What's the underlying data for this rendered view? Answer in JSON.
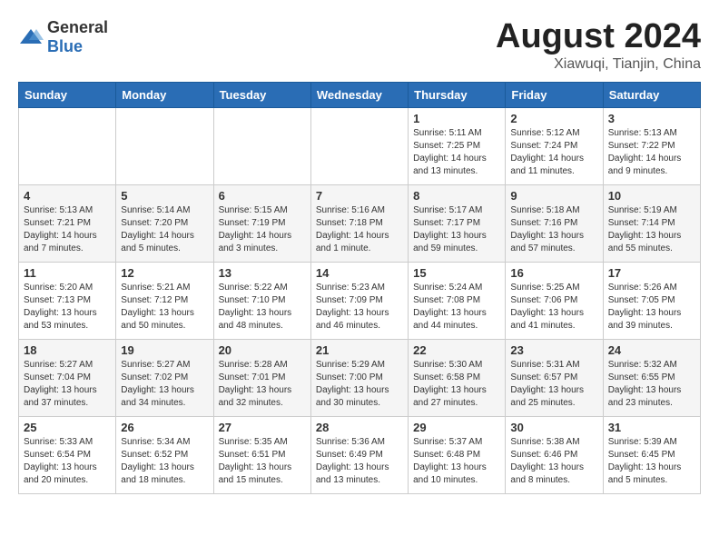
{
  "header": {
    "logo_general": "General",
    "logo_blue": "Blue",
    "title": "August 2024",
    "subtitle": "Xiawuqi, Tianjin, China"
  },
  "weekdays": [
    "Sunday",
    "Monday",
    "Tuesday",
    "Wednesday",
    "Thursday",
    "Friday",
    "Saturday"
  ],
  "weeks": [
    [
      {
        "day": "",
        "info": ""
      },
      {
        "day": "",
        "info": ""
      },
      {
        "day": "",
        "info": ""
      },
      {
        "day": "",
        "info": ""
      },
      {
        "day": "1",
        "info": "Sunrise: 5:11 AM\nSunset: 7:25 PM\nDaylight: 14 hours\nand 13 minutes."
      },
      {
        "day": "2",
        "info": "Sunrise: 5:12 AM\nSunset: 7:24 PM\nDaylight: 14 hours\nand 11 minutes."
      },
      {
        "day": "3",
        "info": "Sunrise: 5:13 AM\nSunset: 7:22 PM\nDaylight: 14 hours\nand 9 minutes."
      }
    ],
    [
      {
        "day": "4",
        "info": "Sunrise: 5:13 AM\nSunset: 7:21 PM\nDaylight: 14 hours\nand 7 minutes."
      },
      {
        "day": "5",
        "info": "Sunrise: 5:14 AM\nSunset: 7:20 PM\nDaylight: 14 hours\nand 5 minutes."
      },
      {
        "day": "6",
        "info": "Sunrise: 5:15 AM\nSunset: 7:19 PM\nDaylight: 14 hours\nand 3 minutes."
      },
      {
        "day": "7",
        "info": "Sunrise: 5:16 AM\nSunset: 7:18 PM\nDaylight: 14 hours\nand 1 minute."
      },
      {
        "day": "8",
        "info": "Sunrise: 5:17 AM\nSunset: 7:17 PM\nDaylight: 13 hours\nand 59 minutes."
      },
      {
        "day": "9",
        "info": "Sunrise: 5:18 AM\nSunset: 7:16 PM\nDaylight: 13 hours\nand 57 minutes."
      },
      {
        "day": "10",
        "info": "Sunrise: 5:19 AM\nSunset: 7:14 PM\nDaylight: 13 hours\nand 55 minutes."
      }
    ],
    [
      {
        "day": "11",
        "info": "Sunrise: 5:20 AM\nSunset: 7:13 PM\nDaylight: 13 hours\nand 53 minutes."
      },
      {
        "day": "12",
        "info": "Sunrise: 5:21 AM\nSunset: 7:12 PM\nDaylight: 13 hours\nand 50 minutes."
      },
      {
        "day": "13",
        "info": "Sunrise: 5:22 AM\nSunset: 7:10 PM\nDaylight: 13 hours\nand 48 minutes."
      },
      {
        "day": "14",
        "info": "Sunrise: 5:23 AM\nSunset: 7:09 PM\nDaylight: 13 hours\nand 46 minutes."
      },
      {
        "day": "15",
        "info": "Sunrise: 5:24 AM\nSunset: 7:08 PM\nDaylight: 13 hours\nand 44 minutes."
      },
      {
        "day": "16",
        "info": "Sunrise: 5:25 AM\nSunset: 7:06 PM\nDaylight: 13 hours\nand 41 minutes."
      },
      {
        "day": "17",
        "info": "Sunrise: 5:26 AM\nSunset: 7:05 PM\nDaylight: 13 hours\nand 39 minutes."
      }
    ],
    [
      {
        "day": "18",
        "info": "Sunrise: 5:27 AM\nSunset: 7:04 PM\nDaylight: 13 hours\nand 37 minutes."
      },
      {
        "day": "19",
        "info": "Sunrise: 5:27 AM\nSunset: 7:02 PM\nDaylight: 13 hours\nand 34 minutes."
      },
      {
        "day": "20",
        "info": "Sunrise: 5:28 AM\nSunset: 7:01 PM\nDaylight: 13 hours\nand 32 minutes."
      },
      {
        "day": "21",
        "info": "Sunrise: 5:29 AM\nSunset: 7:00 PM\nDaylight: 13 hours\nand 30 minutes."
      },
      {
        "day": "22",
        "info": "Sunrise: 5:30 AM\nSunset: 6:58 PM\nDaylight: 13 hours\nand 27 minutes."
      },
      {
        "day": "23",
        "info": "Sunrise: 5:31 AM\nSunset: 6:57 PM\nDaylight: 13 hours\nand 25 minutes."
      },
      {
        "day": "24",
        "info": "Sunrise: 5:32 AM\nSunset: 6:55 PM\nDaylight: 13 hours\nand 23 minutes."
      }
    ],
    [
      {
        "day": "25",
        "info": "Sunrise: 5:33 AM\nSunset: 6:54 PM\nDaylight: 13 hours\nand 20 minutes."
      },
      {
        "day": "26",
        "info": "Sunrise: 5:34 AM\nSunset: 6:52 PM\nDaylight: 13 hours\nand 18 minutes."
      },
      {
        "day": "27",
        "info": "Sunrise: 5:35 AM\nSunset: 6:51 PM\nDaylight: 13 hours\nand 15 minutes."
      },
      {
        "day": "28",
        "info": "Sunrise: 5:36 AM\nSunset: 6:49 PM\nDaylight: 13 hours\nand 13 minutes."
      },
      {
        "day": "29",
        "info": "Sunrise: 5:37 AM\nSunset: 6:48 PM\nDaylight: 13 hours\nand 10 minutes."
      },
      {
        "day": "30",
        "info": "Sunrise: 5:38 AM\nSunset: 6:46 PM\nDaylight: 13 hours\nand 8 minutes."
      },
      {
        "day": "31",
        "info": "Sunrise: 5:39 AM\nSunset: 6:45 PM\nDaylight: 13 hours\nand 5 minutes."
      }
    ]
  ]
}
